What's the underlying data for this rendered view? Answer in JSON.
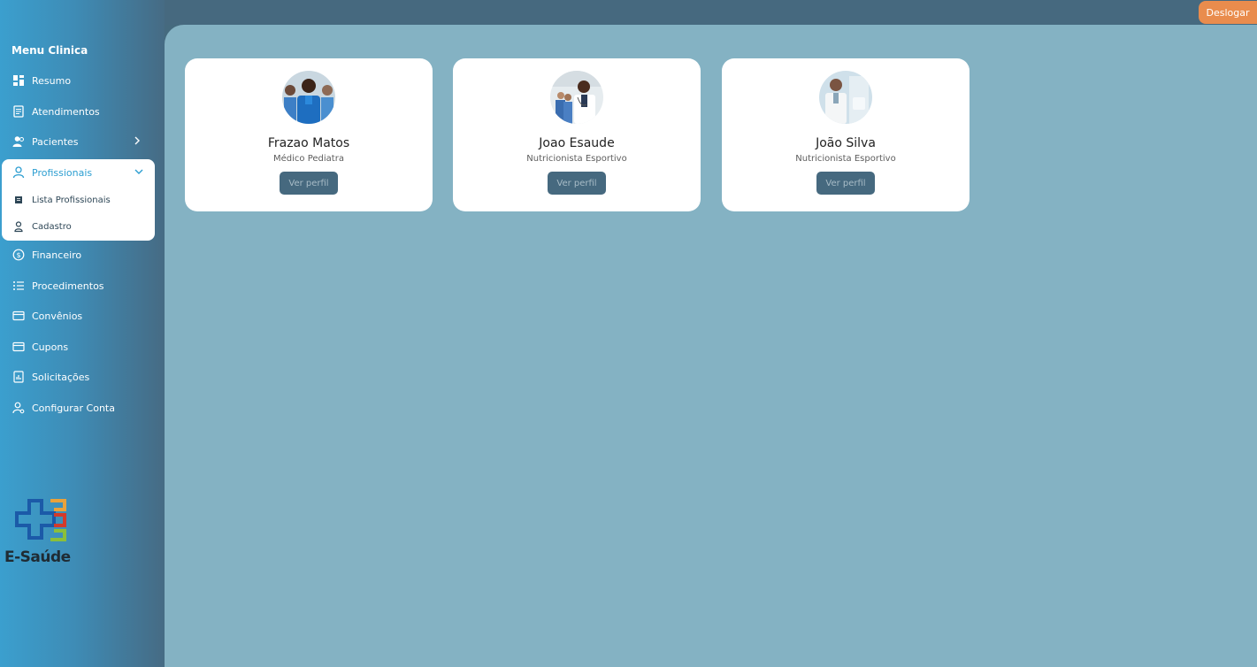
{
  "header": {
    "logout_label": "Deslogar"
  },
  "sidebar": {
    "title": "Menu Clinica",
    "items": [
      {
        "label": "Resumo",
        "icon": "dashboard-icon"
      },
      {
        "label": "Atendimentos",
        "icon": "document-icon"
      },
      {
        "label": "Pacientes",
        "icon": "users-icon"
      },
      {
        "label": "Profissionais",
        "icon": "user-icon"
      },
      {
        "label": "Financeiro",
        "icon": "dollar-icon"
      },
      {
        "label": "Procedimentos",
        "icon": "list-icon"
      },
      {
        "label": "Convênios",
        "icon": "card-icon"
      },
      {
        "label": "Cupons",
        "icon": "card-icon"
      },
      {
        "label": "Solicitações",
        "icon": "report-icon"
      },
      {
        "label": "Configurar Conta",
        "icon": "user-settings-icon"
      }
    ],
    "submenu": [
      {
        "label": "Lista Profissionais",
        "icon": "square-icon"
      },
      {
        "label": "Cadastro",
        "icon": "person-icon"
      }
    ],
    "brand": "E-Saúde"
  },
  "colors": {
    "accent": "#2c9ed1",
    "logout": "#e98c4d",
    "main_bg": "#84b2c3",
    "button": "#46697f"
  },
  "professionals": [
    {
      "name": "Frazao Matos",
      "role": "Médico Pediatra",
      "button": "Ver perfil"
    },
    {
      "name": "Joao Esaude",
      "role": "Nutricionista Esportivo",
      "button": "Ver perfil"
    },
    {
      "name": "João Silva",
      "role": "Nutricionista Esportivo",
      "button": "Ver perfil"
    }
  ]
}
